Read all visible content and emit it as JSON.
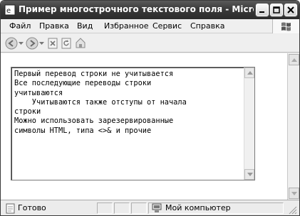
{
  "window": {
    "title": "Пример многострочного текстового поля - Microsoft Internet Explorer"
  },
  "menu": {
    "items": [
      {
        "label": "Файл"
      },
      {
        "label": "Правка"
      },
      {
        "label": "Вид"
      },
      {
        "label": "Избранное"
      },
      {
        "label": "Сервис"
      },
      {
        "label": "Справка"
      }
    ]
  },
  "textarea": {
    "value": "Первый перевод строки не учитывается\nВсе последующие переводы строки\nучитываются\n    Учитываются также отступы от начала\nстроки\nМожно использовать зарезервированные\nсимволы HTML, типа <>& и прочие"
  },
  "statusbar": {
    "status": "Готово",
    "zone": "Мой компьютер"
  },
  "icons": {
    "app": "ie-icon",
    "back": "back-icon",
    "forward": "forward-icon",
    "stop": "stop-icon",
    "refresh": "refresh-icon",
    "home": "home-icon",
    "zone": "computer-icon"
  }
}
